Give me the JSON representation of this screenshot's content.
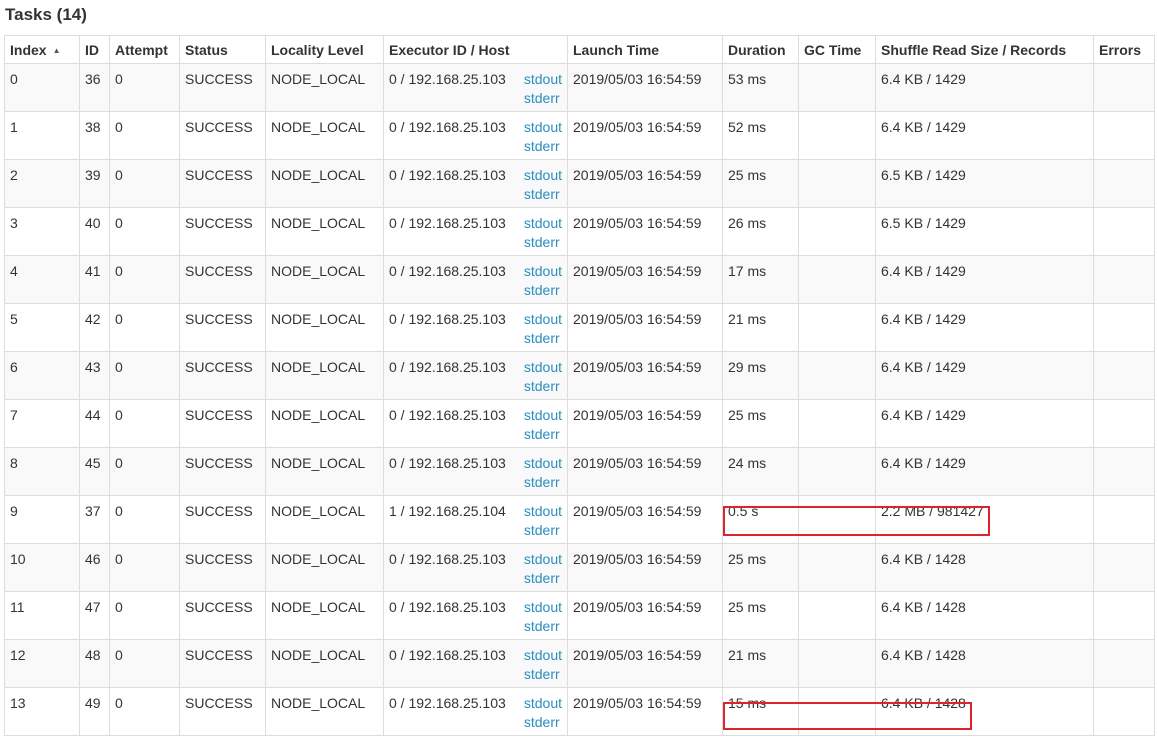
{
  "title": "Tasks (14)",
  "columns": [
    "Index",
    "ID",
    "Attempt",
    "Status",
    "Locality Level",
    "Executor ID / Host",
    "Launch Time",
    "Duration",
    "GC Time",
    "Shuffle Read Size / Records",
    "Errors"
  ],
  "sort_indicator": "▲",
  "log_links": {
    "stdout": "stdout",
    "stderr": "stderr"
  },
  "rows": [
    {
      "index": "0",
      "id": "36",
      "attempt": "0",
      "status": "SUCCESS",
      "locality": "NODE_LOCAL",
      "executor": "0 / 192.168.25.103",
      "launch": "2019/05/03 16:54:59",
      "duration": "53 ms",
      "gc": "",
      "shuffle": "6.4 KB / 1429",
      "errors": ""
    },
    {
      "index": "1",
      "id": "38",
      "attempt": "0",
      "status": "SUCCESS",
      "locality": "NODE_LOCAL",
      "executor": "0 / 192.168.25.103",
      "launch": "2019/05/03 16:54:59",
      "duration": "52 ms",
      "gc": "",
      "shuffle": "6.4 KB / 1429",
      "errors": ""
    },
    {
      "index": "2",
      "id": "39",
      "attempt": "0",
      "status": "SUCCESS",
      "locality": "NODE_LOCAL",
      "executor": "0 / 192.168.25.103",
      "launch": "2019/05/03 16:54:59",
      "duration": "25 ms",
      "gc": "",
      "shuffle": "6.5 KB / 1429",
      "errors": ""
    },
    {
      "index": "3",
      "id": "40",
      "attempt": "0",
      "status": "SUCCESS",
      "locality": "NODE_LOCAL",
      "executor": "0 / 192.168.25.103",
      "launch": "2019/05/03 16:54:59",
      "duration": "26 ms",
      "gc": "",
      "shuffle": "6.5 KB / 1429",
      "errors": ""
    },
    {
      "index": "4",
      "id": "41",
      "attempt": "0",
      "status": "SUCCESS",
      "locality": "NODE_LOCAL",
      "executor": "0 / 192.168.25.103",
      "launch": "2019/05/03 16:54:59",
      "duration": "17 ms",
      "gc": "",
      "shuffle": "6.4 KB / 1429",
      "errors": ""
    },
    {
      "index": "5",
      "id": "42",
      "attempt": "0",
      "status": "SUCCESS",
      "locality": "NODE_LOCAL",
      "executor": "0 / 192.168.25.103",
      "launch": "2019/05/03 16:54:59",
      "duration": "21 ms",
      "gc": "",
      "shuffle": "6.4 KB / 1429",
      "errors": ""
    },
    {
      "index": "6",
      "id": "43",
      "attempt": "0",
      "status": "SUCCESS",
      "locality": "NODE_LOCAL",
      "executor": "0 / 192.168.25.103",
      "launch": "2019/05/03 16:54:59",
      "duration": "29 ms",
      "gc": "",
      "shuffle": "6.4 KB / 1429",
      "errors": ""
    },
    {
      "index": "7",
      "id": "44",
      "attempt": "0",
      "status": "SUCCESS",
      "locality": "NODE_LOCAL",
      "executor": "0 / 192.168.25.103",
      "launch": "2019/05/03 16:54:59",
      "duration": "25 ms",
      "gc": "",
      "shuffle": "6.4 KB / 1429",
      "errors": ""
    },
    {
      "index": "8",
      "id": "45",
      "attempt": "0",
      "status": "SUCCESS",
      "locality": "NODE_LOCAL",
      "executor": "0 / 192.168.25.103",
      "launch": "2019/05/03 16:54:59",
      "duration": "24 ms",
      "gc": "",
      "shuffle": "6.4 KB / 1429",
      "errors": ""
    },
    {
      "index": "9",
      "id": "37",
      "attempt": "0",
      "status": "SUCCESS",
      "locality": "NODE_LOCAL",
      "executor": "1 / 192.168.25.104",
      "launch": "2019/05/03 16:54:59",
      "duration": "0.5 s",
      "gc": "",
      "shuffle": "2.2 MB / 981427",
      "errors": ""
    },
    {
      "index": "10",
      "id": "46",
      "attempt": "0",
      "status": "SUCCESS",
      "locality": "NODE_LOCAL",
      "executor": "0 / 192.168.25.103",
      "launch": "2019/05/03 16:54:59",
      "duration": "25 ms",
      "gc": "",
      "shuffle": "6.4 KB / 1428",
      "errors": ""
    },
    {
      "index": "11",
      "id": "47",
      "attempt": "0",
      "status": "SUCCESS",
      "locality": "NODE_LOCAL",
      "executor": "0 / 192.168.25.103",
      "launch": "2019/05/03 16:54:59",
      "duration": "25 ms",
      "gc": "",
      "shuffle": "6.4 KB / 1428",
      "errors": ""
    },
    {
      "index": "12",
      "id": "48",
      "attempt": "0",
      "status": "SUCCESS",
      "locality": "NODE_LOCAL",
      "executor": "0 / 192.168.25.103",
      "launch": "2019/05/03 16:54:59",
      "duration": "21 ms",
      "gc": "",
      "shuffle": "6.4 KB / 1428",
      "errors": ""
    },
    {
      "index": "13",
      "id": "49",
      "attempt": "0",
      "status": "SUCCESS",
      "locality": "NODE_LOCAL",
      "executor": "0 / 192.168.25.103",
      "launch": "2019/05/03 16:54:59",
      "duration": "15 ms",
      "gc": "",
      "shuffle": "6.4 KB / 1428",
      "errors": ""
    }
  ],
  "colors": {
    "link": "#2a8ebf",
    "highlight": "#d9252b",
    "stripe": "#f9f9f9",
    "border": "#dddddd"
  }
}
